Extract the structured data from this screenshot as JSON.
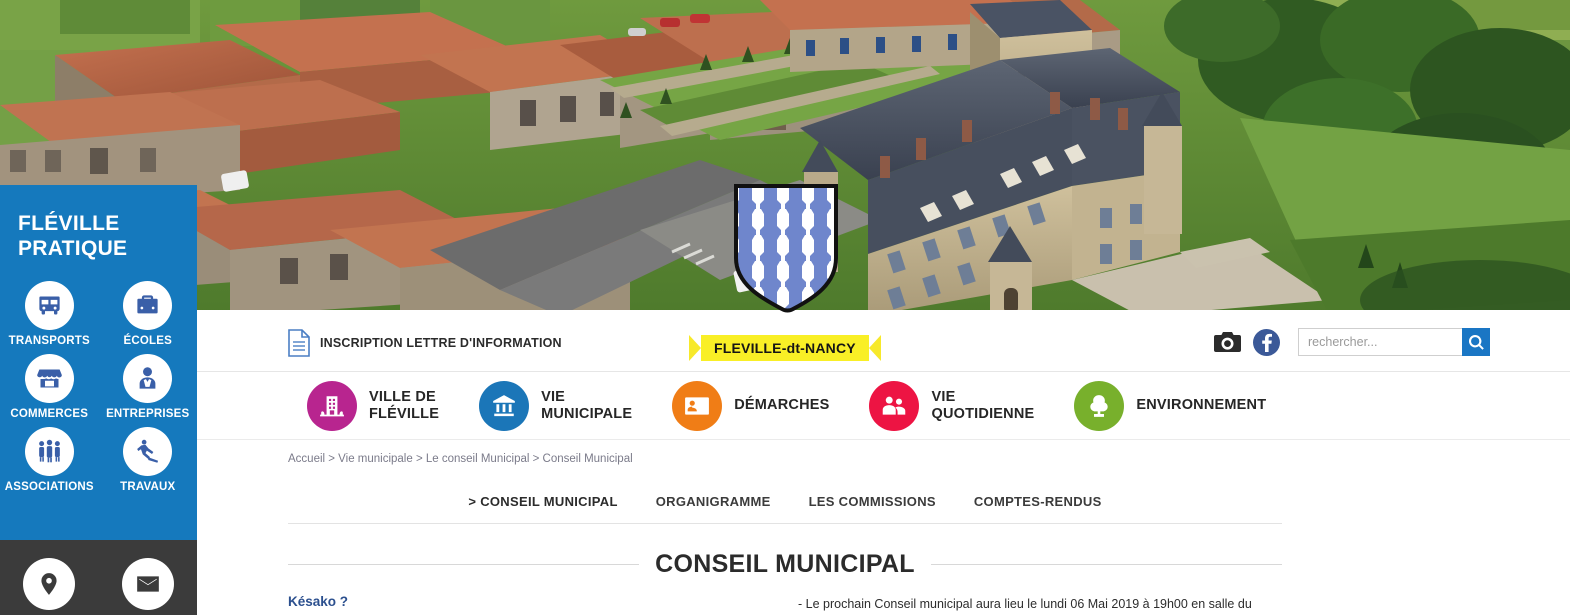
{
  "site": {
    "banner_ribbon": "FLEVILLE-dt-NANCY",
    "crest_alt": "coat-of-arms"
  },
  "sidebar": {
    "title_line1": "FLÉVILLE",
    "title_line2": "PRATIQUE",
    "items": [
      {
        "label": "TRANSPORTS",
        "icon": "bus-icon"
      },
      {
        "label": "ÉCOLES",
        "icon": "briefcase-icon"
      },
      {
        "label": "COMMERCES",
        "icon": "shop-icon"
      },
      {
        "label": "ENTREPRISES",
        "icon": "businessman-icon"
      },
      {
        "label": "ASSOCIATIONS",
        "icon": "people-icon"
      },
      {
        "label": "TRAVAUX",
        "icon": "roadworks-icon"
      }
    ],
    "dark_actions": [
      {
        "icon": "map-pin-icon"
      },
      {
        "icon": "envelope-icon"
      }
    ]
  },
  "utility": {
    "newsletter_label": "INSCRIPTION LETTRE D'INFORMATION",
    "newsletter_icon": "document-icon",
    "camera_icon": "camera-icon",
    "facebook_icon": "facebook-icon",
    "search": {
      "placeholder": "rechercher...",
      "value": "",
      "button_icon": "search-icon"
    }
  },
  "mainnav": {
    "items": [
      {
        "label": "VILLE DE\nFLÉVILLE",
        "icon": "building-icon",
        "color": "#b8258f"
      },
      {
        "label": "VIE\nMUNICIPALE",
        "icon": "bank-icon",
        "color": "#1b76b8"
      },
      {
        "label": "DÉMARCHES",
        "icon": "id-card-icon",
        "color": "#f07d16"
      },
      {
        "label": "VIE\nQUOTIDIENNE",
        "icon": "family-icon",
        "color": "#ed1443"
      },
      {
        "label": "ENVIRONNEMENT",
        "icon": "tree-icon",
        "color": "#78b02c"
      }
    ]
  },
  "breadcrumb": {
    "text": "Accueil > Vie municipale > Le conseil Municipal > Conseil Municipal"
  },
  "subnav": {
    "items": [
      {
        "label": "> CONSEIL MUNICIPAL",
        "active": true
      },
      {
        "label": "ORGANIGRAMME",
        "active": false
      },
      {
        "label": "LES COMMISSIONS",
        "active": false
      },
      {
        "label": "COMPTES-RENDUS",
        "active": false
      }
    ]
  },
  "page": {
    "title": "CONSEIL MUNICIPAL",
    "left_heading": "Késako ?",
    "right_paragraph": "- Le prochain Conseil municipal aura lieu le lundi 06 Mai 2019 à 19h00 en salle du"
  },
  "colors": {
    "sidebar_blue": "#1579bd",
    "sidebar_dark": "#3b3b3b",
    "ribbon_yellow": "#f9ef26",
    "search_button": "#1a76c4",
    "crest_blue": "#6f86cc",
    "link_blue": "#2b4f8e"
  }
}
